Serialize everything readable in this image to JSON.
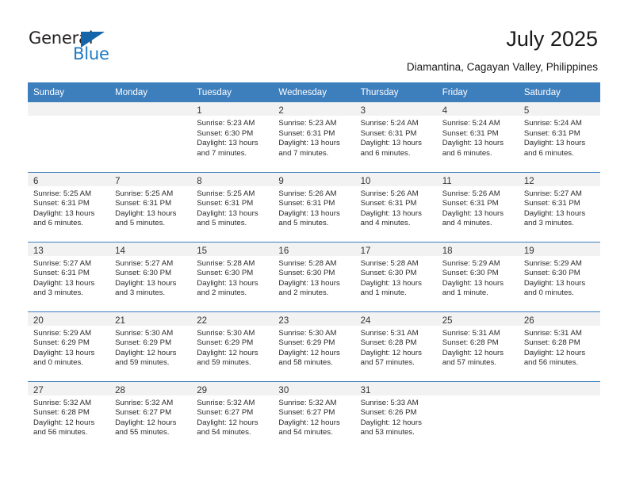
{
  "brand": {
    "name_primary": "General",
    "name_secondary": "Blue",
    "triangle_icon": "triangle-icon",
    "accent_color": "#1565ab",
    "blue_text_color": "#1f7bc4"
  },
  "header": {
    "title": "July 2025",
    "subtitle": "Diamantina, Cagayan Valley, Philippines"
  },
  "calendar": {
    "header_bg_color": "#3d7ebd",
    "daynum_band_color": "#f2f2f2",
    "weekday_headers": [
      "Sunday",
      "Monday",
      "Tuesday",
      "Wednesday",
      "Thursday",
      "Friday",
      "Saturday"
    ],
    "weeks": [
      [
        {
          "day": "",
          "sunrise": "",
          "sunset": "",
          "daylight_1": "",
          "daylight_2": ""
        },
        {
          "day": "",
          "sunrise": "",
          "sunset": "",
          "daylight_1": "",
          "daylight_2": ""
        },
        {
          "day": "1",
          "sunrise": "Sunrise: 5:23 AM",
          "sunset": "Sunset: 6:30 PM",
          "daylight_1": "Daylight: 13 hours",
          "daylight_2": "and 7 minutes."
        },
        {
          "day": "2",
          "sunrise": "Sunrise: 5:23 AM",
          "sunset": "Sunset: 6:31 PM",
          "daylight_1": "Daylight: 13 hours",
          "daylight_2": "and 7 minutes."
        },
        {
          "day": "3",
          "sunrise": "Sunrise: 5:24 AM",
          "sunset": "Sunset: 6:31 PM",
          "daylight_1": "Daylight: 13 hours",
          "daylight_2": "and 6 minutes."
        },
        {
          "day": "4",
          "sunrise": "Sunrise: 5:24 AM",
          "sunset": "Sunset: 6:31 PM",
          "daylight_1": "Daylight: 13 hours",
          "daylight_2": "and 6 minutes."
        },
        {
          "day": "5",
          "sunrise": "Sunrise: 5:24 AM",
          "sunset": "Sunset: 6:31 PM",
          "daylight_1": "Daylight: 13 hours",
          "daylight_2": "and 6 minutes."
        }
      ],
      [
        {
          "day": "6",
          "sunrise": "Sunrise: 5:25 AM",
          "sunset": "Sunset: 6:31 PM",
          "daylight_1": "Daylight: 13 hours",
          "daylight_2": "and 6 minutes."
        },
        {
          "day": "7",
          "sunrise": "Sunrise: 5:25 AM",
          "sunset": "Sunset: 6:31 PM",
          "daylight_1": "Daylight: 13 hours",
          "daylight_2": "and 5 minutes."
        },
        {
          "day": "8",
          "sunrise": "Sunrise: 5:25 AM",
          "sunset": "Sunset: 6:31 PM",
          "daylight_1": "Daylight: 13 hours",
          "daylight_2": "and 5 minutes."
        },
        {
          "day": "9",
          "sunrise": "Sunrise: 5:26 AM",
          "sunset": "Sunset: 6:31 PM",
          "daylight_1": "Daylight: 13 hours",
          "daylight_2": "and 5 minutes."
        },
        {
          "day": "10",
          "sunrise": "Sunrise: 5:26 AM",
          "sunset": "Sunset: 6:31 PM",
          "daylight_1": "Daylight: 13 hours",
          "daylight_2": "and 4 minutes."
        },
        {
          "day": "11",
          "sunrise": "Sunrise: 5:26 AM",
          "sunset": "Sunset: 6:31 PM",
          "daylight_1": "Daylight: 13 hours",
          "daylight_2": "and 4 minutes."
        },
        {
          "day": "12",
          "sunrise": "Sunrise: 5:27 AM",
          "sunset": "Sunset: 6:31 PM",
          "daylight_1": "Daylight: 13 hours",
          "daylight_2": "and 3 minutes."
        }
      ],
      [
        {
          "day": "13",
          "sunrise": "Sunrise: 5:27 AM",
          "sunset": "Sunset: 6:31 PM",
          "daylight_1": "Daylight: 13 hours",
          "daylight_2": "and 3 minutes."
        },
        {
          "day": "14",
          "sunrise": "Sunrise: 5:27 AM",
          "sunset": "Sunset: 6:30 PM",
          "daylight_1": "Daylight: 13 hours",
          "daylight_2": "and 3 minutes."
        },
        {
          "day": "15",
          "sunrise": "Sunrise: 5:28 AM",
          "sunset": "Sunset: 6:30 PM",
          "daylight_1": "Daylight: 13 hours",
          "daylight_2": "and 2 minutes."
        },
        {
          "day": "16",
          "sunrise": "Sunrise: 5:28 AM",
          "sunset": "Sunset: 6:30 PM",
          "daylight_1": "Daylight: 13 hours",
          "daylight_2": "and 2 minutes."
        },
        {
          "day": "17",
          "sunrise": "Sunrise: 5:28 AM",
          "sunset": "Sunset: 6:30 PM",
          "daylight_1": "Daylight: 13 hours",
          "daylight_2": "and 1 minute."
        },
        {
          "day": "18",
          "sunrise": "Sunrise: 5:29 AM",
          "sunset": "Sunset: 6:30 PM",
          "daylight_1": "Daylight: 13 hours",
          "daylight_2": "and 1 minute."
        },
        {
          "day": "19",
          "sunrise": "Sunrise: 5:29 AM",
          "sunset": "Sunset: 6:30 PM",
          "daylight_1": "Daylight: 13 hours",
          "daylight_2": "and 0 minutes."
        }
      ],
      [
        {
          "day": "20",
          "sunrise": "Sunrise: 5:29 AM",
          "sunset": "Sunset: 6:29 PM",
          "daylight_1": "Daylight: 13 hours",
          "daylight_2": "and 0 minutes."
        },
        {
          "day": "21",
          "sunrise": "Sunrise: 5:30 AM",
          "sunset": "Sunset: 6:29 PM",
          "daylight_1": "Daylight: 12 hours",
          "daylight_2": "and 59 minutes."
        },
        {
          "day": "22",
          "sunrise": "Sunrise: 5:30 AM",
          "sunset": "Sunset: 6:29 PM",
          "daylight_1": "Daylight: 12 hours",
          "daylight_2": "and 59 minutes."
        },
        {
          "day": "23",
          "sunrise": "Sunrise: 5:30 AM",
          "sunset": "Sunset: 6:29 PM",
          "daylight_1": "Daylight: 12 hours",
          "daylight_2": "and 58 minutes."
        },
        {
          "day": "24",
          "sunrise": "Sunrise: 5:31 AM",
          "sunset": "Sunset: 6:28 PM",
          "daylight_1": "Daylight: 12 hours",
          "daylight_2": "and 57 minutes."
        },
        {
          "day": "25",
          "sunrise": "Sunrise: 5:31 AM",
          "sunset": "Sunset: 6:28 PM",
          "daylight_1": "Daylight: 12 hours",
          "daylight_2": "and 57 minutes."
        },
        {
          "day": "26",
          "sunrise": "Sunrise: 5:31 AM",
          "sunset": "Sunset: 6:28 PM",
          "daylight_1": "Daylight: 12 hours",
          "daylight_2": "and 56 minutes."
        }
      ],
      [
        {
          "day": "27",
          "sunrise": "Sunrise: 5:32 AM",
          "sunset": "Sunset: 6:28 PM",
          "daylight_1": "Daylight: 12 hours",
          "daylight_2": "and 56 minutes."
        },
        {
          "day": "28",
          "sunrise": "Sunrise: 5:32 AM",
          "sunset": "Sunset: 6:27 PM",
          "daylight_1": "Daylight: 12 hours",
          "daylight_2": "and 55 minutes."
        },
        {
          "day": "29",
          "sunrise": "Sunrise: 5:32 AM",
          "sunset": "Sunset: 6:27 PM",
          "daylight_1": "Daylight: 12 hours",
          "daylight_2": "and 54 minutes."
        },
        {
          "day": "30",
          "sunrise": "Sunrise: 5:32 AM",
          "sunset": "Sunset: 6:27 PM",
          "daylight_1": "Daylight: 12 hours",
          "daylight_2": "and 54 minutes."
        },
        {
          "day": "31",
          "sunrise": "Sunrise: 5:33 AM",
          "sunset": "Sunset: 6:26 PM",
          "daylight_1": "Daylight: 12 hours",
          "daylight_2": "and 53 minutes."
        },
        {
          "day": "",
          "sunrise": "",
          "sunset": "",
          "daylight_1": "",
          "daylight_2": ""
        },
        {
          "day": "",
          "sunrise": "",
          "sunset": "",
          "daylight_1": "",
          "daylight_2": ""
        }
      ]
    ]
  }
}
